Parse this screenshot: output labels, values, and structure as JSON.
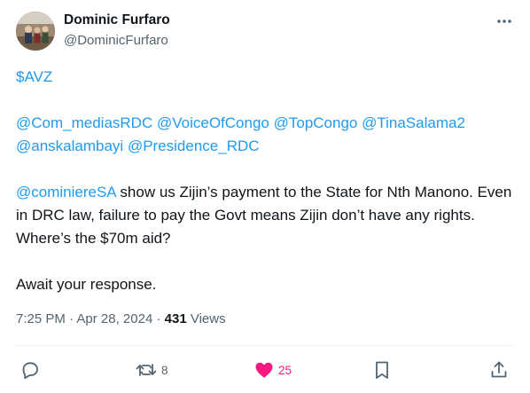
{
  "author": {
    "name": "Dominic Furfaro",
    "handle": "@DominicFurfaro"
  },
  "tweet": {
    "cashtag": "$AVZ",
    "mentions": {
      "m1": "@Com_mediasRDC",
      "m2": "@VoiceOfCongo",
      "m3": "@TopCongo",
      "m4": "@TinaSalama2",
      "m5": "@anskalambayi",
      "m6": "@Presidence_RDC"
    },
    "reply_mention": "@cominiereSA",
    "reply_text": " show us Zijin’s payment to the State for Nth Manono. Even in DRC law, failure to pay the Govt means Zijin don’t have any rights. Where’s the $70m aid?",
    "closing": "Await your response."
  },
  "meta": {
    "time": "7:25 PM",
    "sep1": " · ",
    "date": "Apr 28, 2024",
    "sep2": " · ",
    "views_count": "431",
    "views_label": " Views"
  },
  "actions": {
    "reposts": "8",
    "likes": "25"
  },
  "colors": {
    "link": "#1d9bf0",
    "like": "#f91880",
    "muted": "#536471"
  }
}
